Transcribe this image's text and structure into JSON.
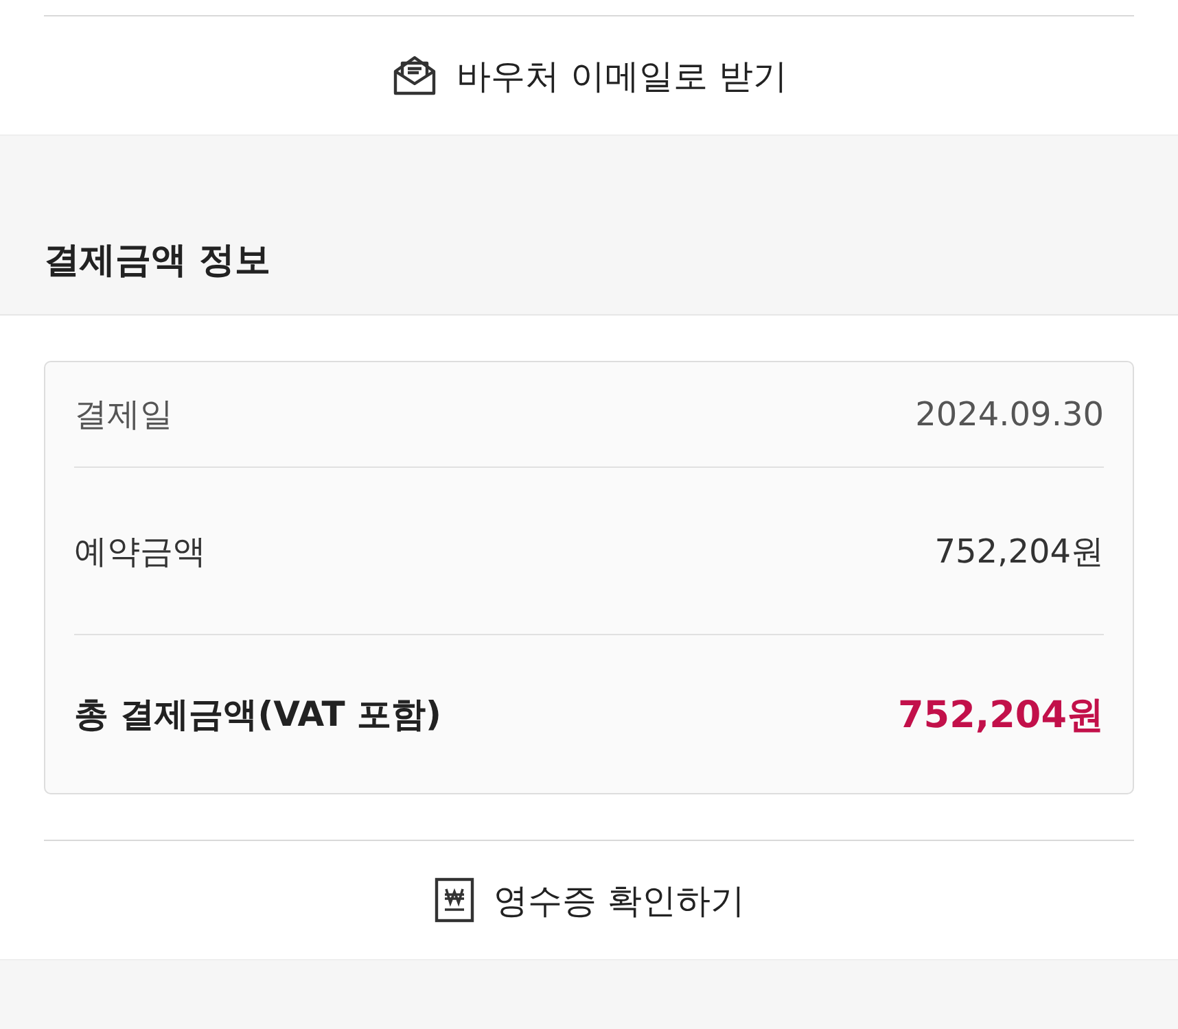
{
  "voucher_button": {
    "label": "바우처 이메일로 받기"
  },
  "section_title": "결제금액 정보",
  "payment_rows": [
    {
      "kind": "plain",
      "label": "결제일",
      "value": "2024.09.30"
    },
    {
      "kind": "plain",
      "label": "예약금액",
      "value": "752,204원"
    },
    {
      "kind": "total",
      "label": "총 결제금액(VAT 포함)",
      "value": "752,204원"
    }
  ],
  "receipt_button": {
    "label": "영수증 확인하기"
  }
}
